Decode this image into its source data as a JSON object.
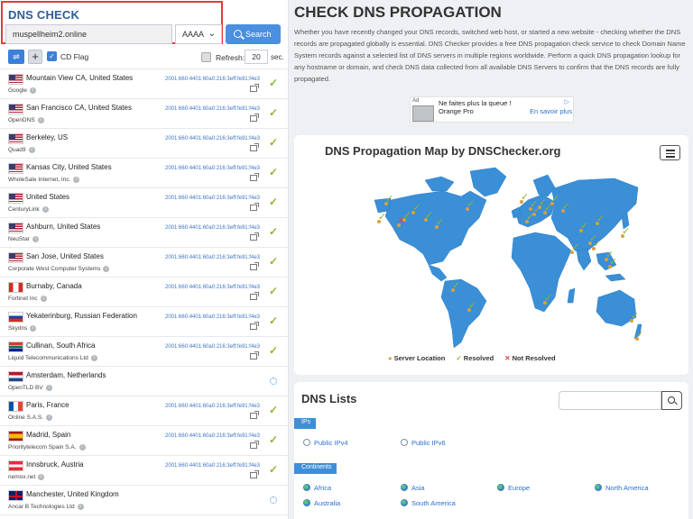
{
  "dns_check": {
    "title": "DNS CHECK",
    "domain_value": "muspellheim2.online",
    "record_type": "AAAA",
    "search_label": "Search",
    "cd_flag_label": "CD Flag",
    "refresh_label": "Refresh:",
    "refresh_value": "20",
    "refresh_unit": "sec."
  },
  "servers": [
    {
      "location": "Mountain View CA, United States",
      "provider": "Google",
      "ip": "2001:660:4401:60a0:216:3eff:fe91:f4e3",
      "status": "resolved",
      "flag": "us"
    },
    {
      "location": "San Francisco CA, United States",
      "provider": "OpenDNS",
      "ip": "2001:660:4401:60a0:216:3eff:fe91:f4e3",
      "status": "resolved",
      "flag": "us"
    },
    {
      "location": "Berkeley, US",
      "provider": "Quad9",
      "ip": "2001:660:4401:60a0:216:3eff:fe91:f4e3",
      "status": "resolved",
      "flag": "us"
    },
    {
      "location": "Kansas City, United States",
      "provider": "WholeSale Internet, Inc.",
      "ip": "2001:660:4401:60a0:216:3eff:fe91:f4e3",
      "status": "resolved",
      "flag": "us"
    },
    {
      "location": "United States",
      "provider": "CenturyLink",
      "ip": "2001:660:4401:60a0:216:3eff:fe91:f4e3",
      "status": "resolved",
      "flag": "us"
    },
    {
      "location": "Ashburn, United States",
      "provider": "NeuStar",
      "ip": "2001:660:4401:60a0:216:3eff:fe91:f4e3",
      "status": "resolved",
      "flag": "us"
    },
    {
      "location": "San Jose, United States",
      "provider": "Corporate West Computer Systems",
      "ip": "2001:660:4401:60a0:216:3eff:fe91:f4e3",
      "status": "resolved",
      "flag": "us"
    },
    {
      "location": "Burnaby, Canada",
      "provider": "Fortinet Inc",
      "ip": "2001:660:4401:60a0:216:3eff:fe91:f4e3",
      "status": "resolved",
      "flag": "ca"
    },
    {
      "location": "Yekaterinburg, Russian Federation",
      "provider": "Skydns",
      "ip": "2001:660:4401:60a0:216:3eff:fe91:f4e3",
      "status": "resolved",
      "flag": "ru"
    },
    {
      "location": "Cullinan, South Africa",
      "provider": "Liquid Telecommunications Ltd",
      "ip": "2001:660:4401:60a0:216:3eff:fe91:f4e3",
      "status": "resolved",
      "flag": "za"
    },
    {
      "location": "Amsterdam, Netherlands",
      "provider": "OpenTLD BV",
      "ip": "",
      "status": "loading",
      "flag": "nl"
    },
    {
      "location": "Paris, France",
      "provider": "Online S.A.S.",
      "ip": "2001:660:4401:60a0:216:3eff:fe91:f4e3",
      "status": "resolved",
      "flag": "fr"
    },
    {
      "location": "Madrid, Spain",
      "provider": "Prioritytelecom Spain S.A.",
      "ip": "2001:660:4401:60a0:216:3eff:fe91:f4e3",
      "status": "resolved",
      "flag": "es"
    },
    {
      "location": "Innsbruck, Austria",
      "provider": "nemox.net",
      "ip": "2001:660:4401:60a0:216:3eff:fe91:f4e3",
      "status": "resolved",
      "flag": "at"
    },
    {
      "location": "Manchester, United Kingdom",
      "provider": "Ancar B Technologies Ltd",
      "ip": "",
      "status": "loading",
      "flag": "gb"
    },
    {
      "location": "",
      "provider": "",
      "ip": "",
      "status": "",
      "flag": "de"
    }
  ],
  "main": {
    "title": "CHECK DNS PROPAGATION",
    "intro": "Whether you have recently changed your DNS records, switched web host, or started a new website - checking whether the DNS records are propagated globally is essential. DNS Checker provides a free DNS propagation check service to check Domain Name System records against a selected list of DNS servers in multiple regions worldwide. Perform a quick DNS propagation lookup for any hostname or domain, and check DNS data collected from all available DNS Servers to confirm that the DNS records are fully propagated."
  },
  "ad": {
    "badge": "Ad",
    "line1": "Ne faites plus la queue !",
    "line2": "Orange Pro",
    "cta": "En savoir plus"
  },
  "map": {
    "title": "DNS Propagation Map by DNSChecker.org",
    "legend_location": "Server Location",
    "legend_resolved": "Resolved",
    "legend_not_resolved": "Not Resolved"
  },
  "lists": {
    "title": "DNS Lists",
    "ips_tag": "IPs",
    "ip_items": [
      "Public IPv4",
      "Public IPv6"
    ],
    "continents_tag": "Continents",
    "continent_items": [
      "Africa",
      "Asia",
      "Europe",
      "North America",
      "Australia",
      "South America"
    ]
  },
  "colors": {
    "accent": "#4a8fe0",
    "title_blue": "#2d5d9a",
    "resolved": "#8fb431",
    "not_resolved": "#e0403b",
    "map_land": "#3a8fd6",
    "highlight_border": "#e23b3b"
  }
}
